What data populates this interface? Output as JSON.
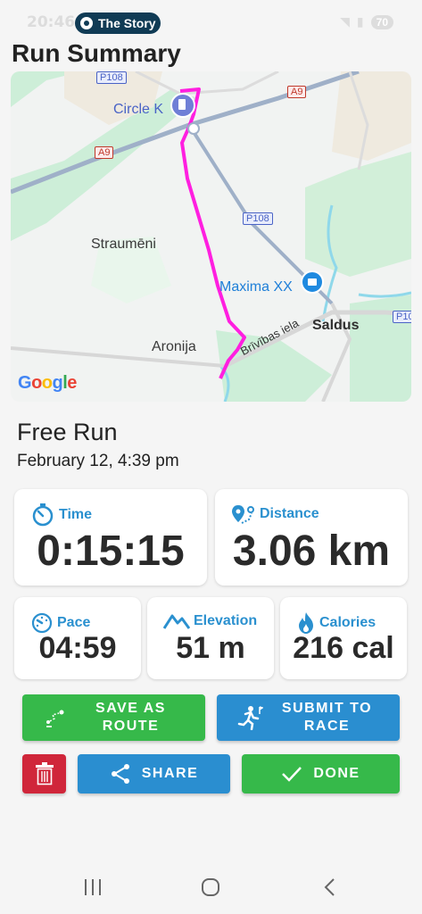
{
  "status_bar": {
    "time": "20:46",
    "pill_text": "The Story",
    "battery": "70"
  },
  "title": "Run Summary",
  "map": {
    "labels": {
      "circle_k": "Circle K",
      "straumeni": "Straumēni",
      "maxima": "Maxima XX",
      "saldus": "Saldus",
      "aronija": "Aronija",
      "street": "Brīvības iela"
    },
    "shields": {
      "p108_top": "P108",
      "a9_right": "A9",
      "a9_left": "A9",
      "p108_mid": "P108",
      "p10_edge": "P10"
    },
    "google": "Google",
    "colors": {
      "route": "#ff1fe0",
      "road": "#8fa3c2",
      "water": "#7fd3e8",
      "green": "#c8ebd3"
    }
  },
  "run": {
    "name": "Free Run",
    "date": "February 12, 4:39 pm"
  },
  "stats": {
    "time": {
      "label": "Time",
      "value": "0:15:15",
      "icon": "stopwatch-icon"
    },
    "distance": {
      "label": "Distance",
      "value": "3.06 km",
      "icon": "map-pin-route-icon"
    },
    "pace": {
      "label": "Pace",
      "value": "04:59",
      "icon": "speedometer-icon"
    },
    "elevation": {
      "label": "Elevation",
      "value": "51 m",
      "icon": "mountain-icon"
    },
    "calories": {
      "label": "Calories",
      "value": "216 cal",
      "icon": "flame-icon"
    }
  },
  "actions": {
    "save_route": "SAVE AS ROUTE",
    "submit_race": "SUBMIT TO RACE",
    "share": "SHARE",
    "done": "DONE",
    "colors": {
      "green": "#36b94a",
      "blue": "#2a8ed0",
      "red": "#d0263a"
    }
  },
  "nav": {
    "recents": "recent-apps-icon",
    "home": "home-icon",
    "back": "back-icon"
  }
}
